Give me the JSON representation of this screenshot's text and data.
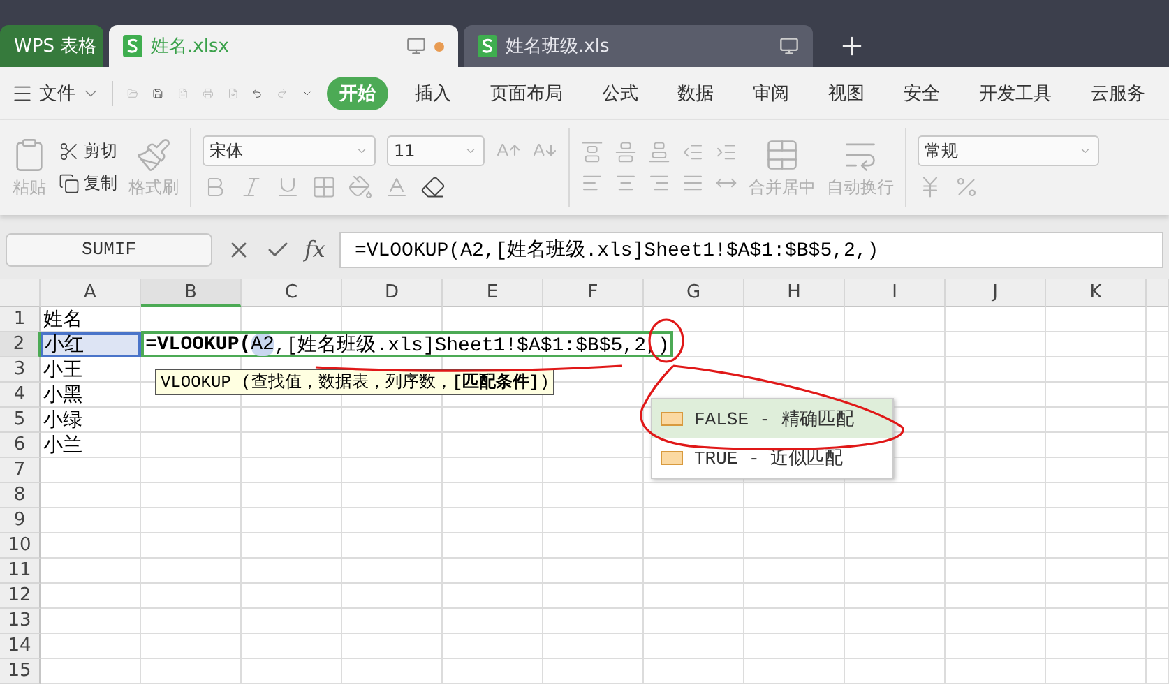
{
  "tabs": [
    {
      "label": "WPS 表格",
      "kind": "app"
    },
    {
      "label": "姓名.xlsx",
      "kind": "doc",
      "selected": true,
      "unsaved": true
    },
    {
      "label": "姓名班级.xls",
      "kind": "doc",
      "selected": false,
      "unsaved": false
    }
  ],
  "menu": {
    "file": "文件",
    "items": [
      {
        "label": "开始",
        "selected": true
      },
      {
        "label": "插入",
        "selected": false
      },
      {
        "label": "页面布局",
        "selected": false
      },
      {
        "label": "公式",
        "selected": false
      },
      {
        "label": "数据",
        "selected": false
      },
      {
        "label": "审阅",
        "selected": false
      },
      {
        "label": "视图",
        "selected": false
      },
      {
        "label": "安全",
        "selected": false
      },
      {
        "label": "开发工具",
        "selected": false
      },
      {
        "label": "云服务",
        "selected": false
      }
    ]
  },
  "ribbon": {
    "paste": "粘贴",
    "cut": "剪切",
    "copy": "复制",
    "format_painter": "格式刷",
    "font": "宋体",
    "font_size": "11",
    "merge": "合并居中",
    "wrap": "自动换行",
    "number_format": "常规"
  },
  "formula_bar": {
    "name_box": "SUMIF",
    "fx": "fx",
    "formula": "=VLOOKUP(A2,[姓名班级.xls]Sheet1!$A$1:$B$5,2,)"
  },
  "sheet": {
    "columns": [
      {
        "label": "A",
        "selected": false
      },
      {
        "label": "B",
        "selected": true
      },
      {
        "label": "C",
        "selected": false
      },
      {
        "label": "D",
        "selected": false
      },
      {
        "label": "E",
        "selected": false
      },
      {
        "label": "F",
        "selected": false
      },
      {
        "label": "G",
        "selected": false
      },
      {
        "label": "H",
        "selected": false
      },
      {
        "label": "I",
        "selected": false
      },
      {
        "label": "J",
        "selected": false
      },
      {
        "label": "K",
        "selected": false
      }
    ],
    "rows": [
      {
        "label": "1",
        "selected": false,
        "cells": [
          "姓名"
        ]
      },
      {
        "label": "2",
        "selected": true,
        "cells": [
          "小红"
        ]
      },
      {
        "label": "3",
        "selected": false,
        "cells": [
          "小王"
        ]
      },
      {
        "label": "4",
        "selected": false,
        "cells": [
          "小黑"
        ]
      },
      {
        "label": "5",
        "selected": false,
        "cells": [
          "小绿"
        ]
      },
      {
        "label": "6",
        "selected": false,
        "cells": [
          "小兰"
        ]
      },
      {
        "label": "7",
        "selected": false,
        "cells": []
      },
      {
        "label": "8",
        "selected": false,
        "cells": []
      },
      {
        "label": "9",
        "selected": false,
        "cells": []
      },
      {
        "label": "10",
        "selected": false,
        "cells": []
      },
      {
        "label": "11",
        "selected": false,
        "cells": []
      },
      {
        "label": "12",
        "selected": false,
        "cells": []
      },
      {
        "label": "13",
        "selected": false,
        "cells": []
      },
      {
        "label": "14",
        "selected": false,
        "cells": []
      },
      {
        "label": "15",
        "selected": false,
        "cells": []
      }
    ],
    "editor": [
      {
        "text": "=",
        "kind": "plain"
      },
      {
        "text": "VLOOKUP(",
        "kind": "function"
      },
      {
        "text": "A2",
        "kind": "reference"
      },
      {
        "text": ",[姓名班级.xls]Sheet1!$A$1:$B$5,2,)",
        "kind": "plain"
      }
    ],
    "tooltip": "VLOOKUP (查找值，数据表，列序数，**[匹配条件]**)",
    "suggestions": [
      {
        "label": "FALSE - 精确匹配",
        "selected": true
      },
      {
        "label": "TRUE - 近似匹配",
        "selected": false
      }
    ]
  }
}
